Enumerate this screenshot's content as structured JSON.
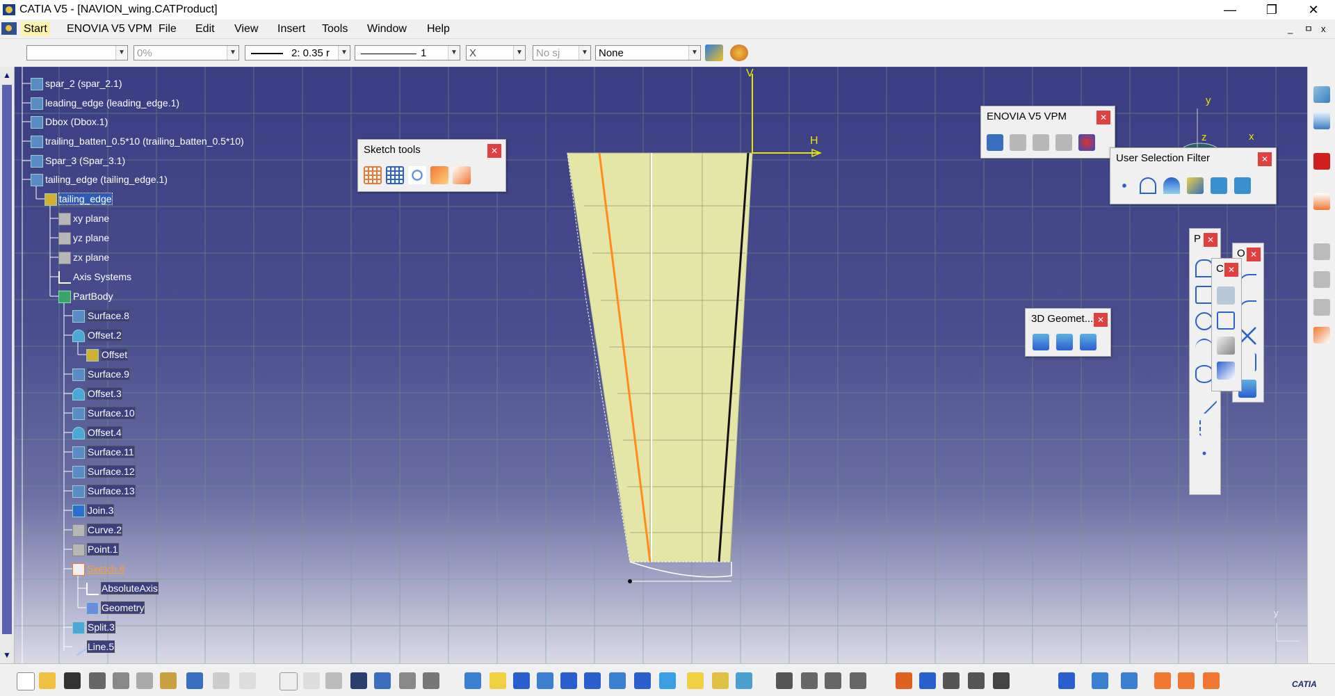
{
  "window": {
    "title": "CATIA V5 - [NAVION_wing.CATProduct]",
    "minimize": "—",
    "restore": "❐",
    "close": "✕"
  },
  "menu": {
    "items": [
      "Start",
      "ENOVIA V5 VPM",
      "File",
      "Edit",
      "View",
      "Insert",
      "Tools",
      "Window",
      "Help"
    ],
    "doc_controls": [
      "_",
      "ㅁ",
      "x"
    ]
  },
  "toolbar": {
    "style_value": "",
    "transparency": "0%",
    "line_thickness": "2: 0.35 r",
    "line_type": "1",
    "point_symbol": "X",
    "layer_filter": "No sj",
    "layer": "None"
  },
  "tree": {
    "items": [
      {
        "label": "spar_2 (spar_2.1)"
      },
      {
        "label": "leading_edge (leading_edge.1)"
      },
      {
        "label": "Dbox (Dbox.1)"
      },
      {
        "label": "trailing_batten_0.5*10 (trailing_batten_0.5*10)"
      },
      {
        "label": "Spar_3 (Spar_3.1)"
      },
      {
        "label": "tailing_edge (tailing_edge.1)"
      },
      {
        "label": "tailing_edge"
      },
      {
        "label": "xy plane"
      },
      {
        "label": "yz plane"
      },
      {
        "label": "zx plane"
      },
      {
        "label": "Axis Systems"
      },
      {
        "label": "PartBody"
      },
      {
        "label": "Surface.8"
      },
      {
        "label": "Offset.2"
      },
      {
        "label": "Offset"
      },
      {
        "label": "Surface.9"
      },
      {
        "label": "Offset.3"
      },
      {
        "label": "Surface.10"
      },
      {
        "label": "Offset.4"
      },
      {
        "label": "Surface.11"
      },
      {
        "label": "Surface.12"
      },
      {
        "label": "Surface.13"
      },
      {
        "label": "Join.3"
      },
      {
        "label": "Curve.2"
      },
      {
        "label": "Point.1"
      },
      {
        "label": "Sketch.6"
      },
      {
        "label": "AbsoluteAxis"
      },
      {
        "label": "Geometry"
      },
      {
        "label": "Split.3"
      },
      {
        "label": "Line.5"
      }
    ]
  },
  "panels": {
    "sketch_tools": {
      "title": "Sketch tools"
    },
    "enovia": {
      "title": "ENOVIA V5 VPM"
    },
    "user_selection_filter": {
      "title": "User Selection Filter"
    },
    "geometry_3d": {
      "title": "3D Geomet..."
    },
    "profile_short": {
      "title": "P"
    },
    "constraint_short": {
      "title": "C"
    },
    "ops_short": {
      "title": "O"
    }
  },
  "canvas": {
    "axis_v": "V",
    "axis_h": "H",
    "compass_y": "y",
    "compass_x": "x",
    "compass_z": "z",
    "corner_y": "y"
  },
  "brand": {
    "logo_text": "CATIA"
  },
  "colors": {
    "viewport_top": "#3a3d82",
    "viewport_bottom": "#d9d9e6",
    "wing_fill": "#e4e6a8",
    "axis": "#e6e600",
    "highlight": "#ff8c1a"
  }
}
